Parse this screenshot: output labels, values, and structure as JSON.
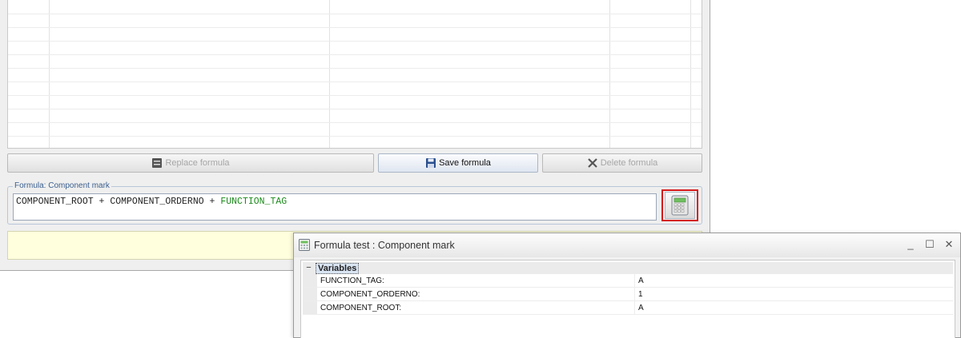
{
  "main": {
    "buttons": {
      "replace_label": "Replace formula",
      "save_label": "Save formula",
      "delete_label": "Delete formula"
    },
    "formula": {
      "legend": "Formula: Component mark",
      "prefix": "COMPONENT_ROOT + COMPONENT_ORDERNO + ",
      "highlighted": "FUNCTION_TAG"
    },
    "calculator_icon": "calculator-icon"
  },
  "dialog": {
    "title": "Formula test : Component mark",
    "collapse_symbol": "−",
    "variables_title": "Variables",
    "variables": [
      {
        "name": "FUNCTION_TAG:",
        "value": "A"
      },
      {
        "name": "COMPONENT_ORDERNO:",
        "value": "1"
      },
      {
        "name": "COMPONENT_ROOT:",
        "value": "A"
      }
    ],
    "window_buttons": {
      "minimize": "_",
      "maximize": "☐",
      "close": "✕"
    }
  },
  "colors": {
    "highlight_border": "#d41a1a",
    "formula_variable": "#1a8a1a",
    "note_background": "#ffffde"
  }
}
